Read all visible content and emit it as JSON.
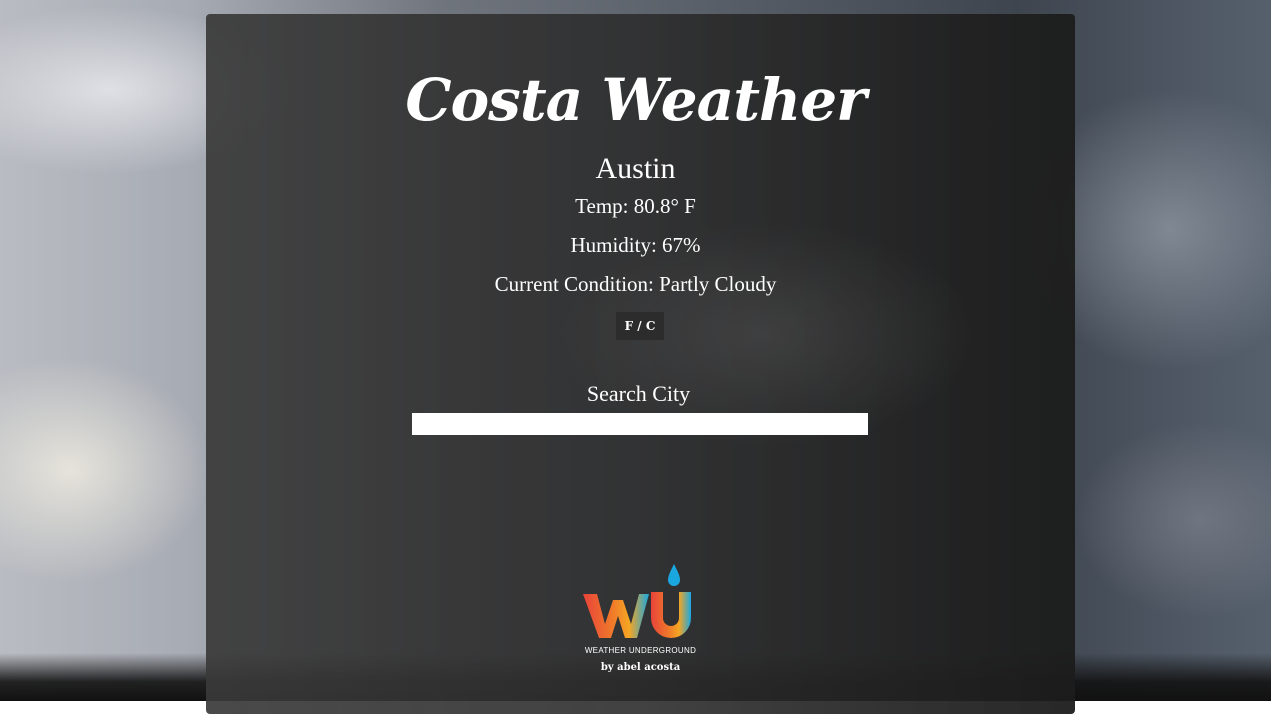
{
  "app": {
    "title": "Costa Weather"
  },
  "weather": {
    "city": "Austin",
    "temp": "Temp: 80.8° F",
    "humidity": "Humidity: 67%",
    "condition": "Current Condition: Partly Cloudy"
  },
  "controls": {
    "unit_toggle_label": "F / C",
    "search_label": "Search City",
    "search_value": "",
    "search_placeholder": ""
  },
  "footer": {
    "logo_icon": "weather-underground-logo",
    "logo_caption": "WEATHER UNDERGROUND",
    "byline": "by abel acosta"
  },
  "colors": {
    "text": "#ffffff",
    "panel": "#2d2d2d",
    "logo_red": "#e8433a",
    "logo_orange": "#f5a623",
    "logo_blue": "#1aa7e0"
  }
}
